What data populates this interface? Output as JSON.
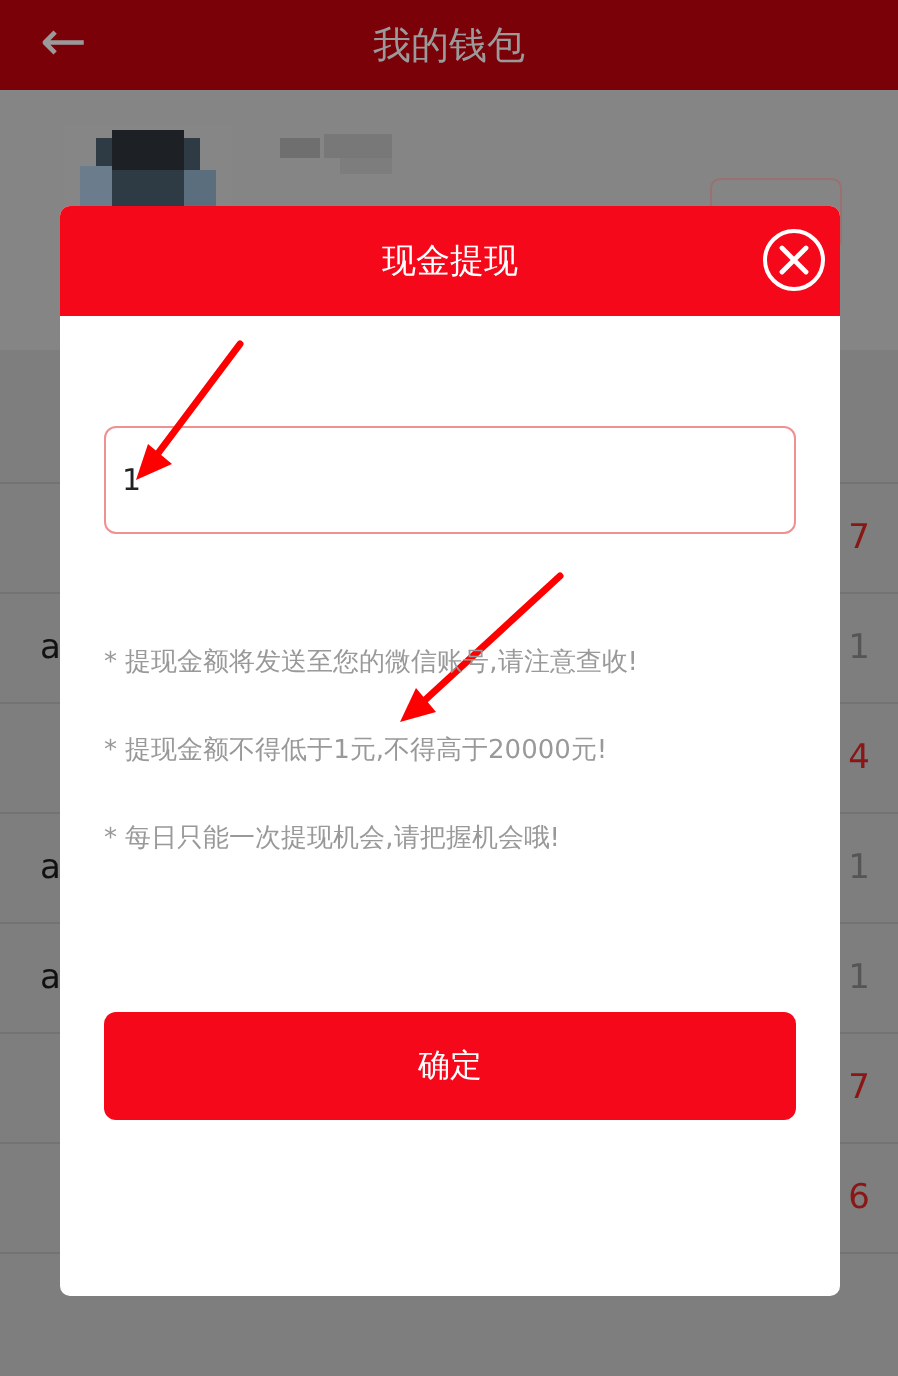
{
  "app_bar": {
    "back_icon": "←",
    "title": "我的钱包"
  },
  "records": [
    {
      "amount": "7",
      "kind": "income"
    },
    {
      "label": "a",
      "amount": "1",
      "kind": "expense"
    },
    {
      "amount": "4",
      "kind": "income"
    },
    {
      "label": "a",
      "amount": "1",
      "kind": "expense"
    },
    {
      "label": "a",
      "amount": "1",
      "kind": "expense"
    },
    {
      "amount": "7",
      "kind": "income"
    },
    {
      "amount": "6",
      "kind": "income"
    }
  ],
  "dialog": {
    "title": "现金提现",
    "amount_field": {
      "value": "1"
    },
    "notes": [
      "* 提现金额将发送至您的微信账号,请注意查收!",
      "* 提现金额不得低于1元,不得高于20000元!",
      "* 每日只能一次提现机会,请把握机会哦!"
    ],
    "confirm_button": "确定"
  }
}
